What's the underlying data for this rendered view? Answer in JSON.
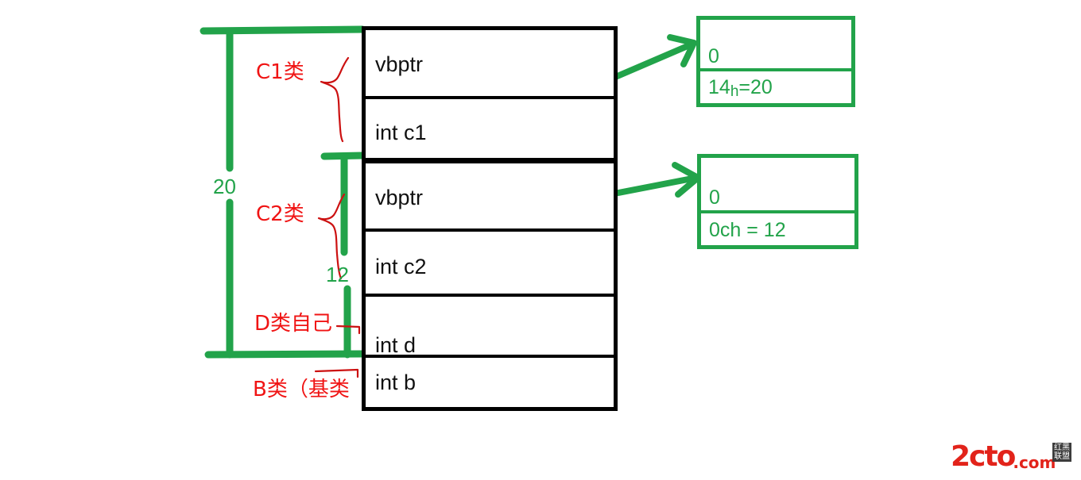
{
  "diagram": {
    "title": "C++ virtual inheritance object memory layout",
    "colors": {
      "green": "#22a34a",
      "red": "#f01414",
      "black": "#000000",
      "watermark_red": "#e2231a"
    }
  },
  "memory_layout": {
    "rows": [
      {
        "label": "vbptr"
      },
      {
        "label": "int c1"
      },
      {
        "label": "vbptr"
      },
      {
        "label": "int c2"
      },
      {
        "label": "int d"
      },
      {
        "label": "int b"
      }
    ]
  },
  "vbtables": [
    {
      "top_value": "0",
      "bottom_value_prefix": "14",
      "bottom_value_sub": "h",
      "bottom_value_suffix": "=20",
      "bottom_value_full": "14h =20"
    },
    {
      "top_value": "0",
      "bottom_value_full": "0ch = 12"
    }
  ],
  "measurements": [
    {
      "label": "20",
      "description": "total-size-bracket"
    },
    {
      "label": "12",
      "description": "offset-bracket"
    }
  ],
  "annotations": [
    {
      "label": "C1类",
      "description": "c1-class-region"
    },
    {
      "label": "C2类",
      "description": "c2-class-region"
    },
    {
      "label": "D类自己",
      "description": "d-class-own-region"
    },
    {
      "label": "B类（基类",
      "description": "b-base-class-region"
    }
  ],
  "watermark": {
    "main": "2cto",
    "suffix": ".com",
    "cn_line1": "红黑",
    "cn_line2": "联盟"
  }
}
